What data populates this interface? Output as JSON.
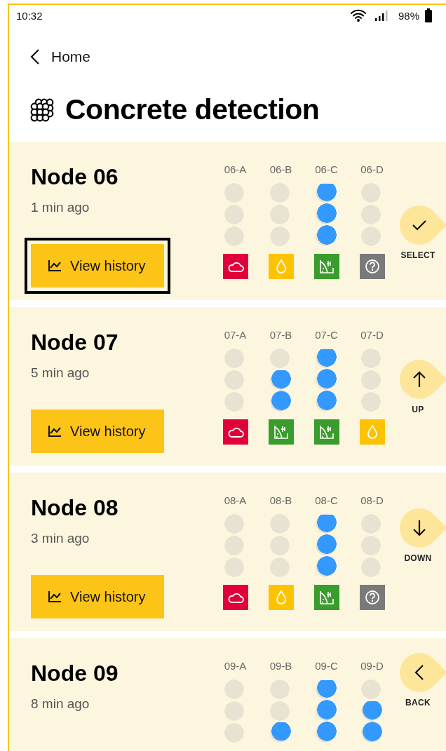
{
  "status_bar": {
    "time": "10:32",
    "battery": "98%"
  },
  "back_link": {
    "label": "Home"
  },
  "title": "Concrete detection",
  "nodes": [
    {
      "name": "Node 06",
      "updated": "1 min ago",
      "button": {
        "label": "View history",
        "focused": true
      },
      "sensors": [
        {
          "label": "06-A",
          "level": 0,
          "kind": "cloud"
        },
        {
          "label": "06-B",
          "level": 0,
          "kind": "drop"
        },
        {
          "label": "06-C",
          "level": 1,
          "kind": "soil"
        },
        {
          "label": "06-D",
          "level": 0,
          "kind": "unknown"
        }
      ]
    },
    {
      "name": "Node 07",
      "updated": "5 min ago",
      "button": {
        "label": "View history",
        "focused": false
      },
      "sensors": [
        {
          "label": "07-A",
          "level": 0,
          "kind": "cloud"
        },
        {
          "label": "07-B",
          "level": 0.67,
          "kind": "soil"
        },
        {
          "label": "07-C",
          "level": 1,
          "kind": "soil"
        },
        {
          "label": "07-D",
          "level": 0,
          "kind": "drop"
        }
      ]
    },
    {
      "name": "Node 08",
      "updated": "3 min ago",
      "button": {
        "label": "View history",
        "focused": false
      },
      "sensors": [
        {
          "label": "08-A",
          "level": 0,
          "kind": "cloud"
        },
        {
          "label": "08-B",
          "level": 0,
          "kind": "drop"
        },
        {
          "label": "08-C",
          "level": 1,
          "kind": "soil"
        },
        {
          "label": "08-D",
          "level": 0,
          "kind": "unknown"
        }
      ]
    },
    {
      "name": "Node 09",
      "updated": "8 min ago",
      "sensors": [
        {
          "label": "09-A",
          "level": 0
        },
        {
          "label": "09-B",
          "level": 0.33
        },
        {
          "label": "09-C",
          "level": 1
        },
        {
          "label": "09-D",
          "level": 0.67
        }
      ]
    }
  ],
  "soft_keys": [
    {
      "label": "SELECT",
      "kind": "select"
    },
    {
      "label": "UP",
      "kind": "up"
    },
    {
      "label": "DOWN",
      "kind": "down"
    },
    {
      "label": "BACK",
      "kind": "back"
    }
  ]
}
